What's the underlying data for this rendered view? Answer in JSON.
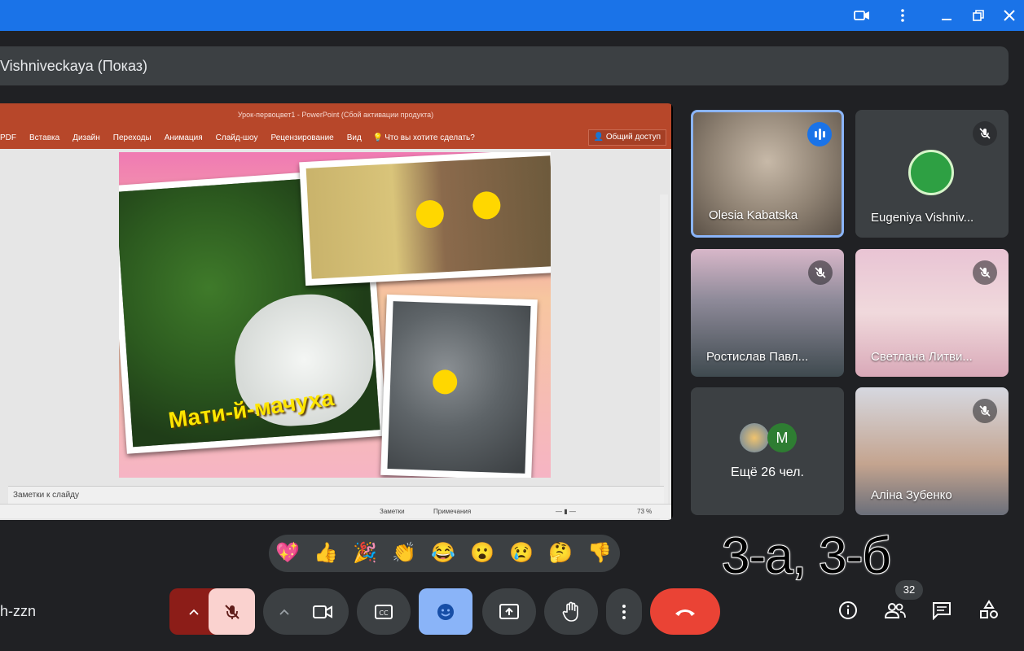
{
  "window": {
    "icons": [
      "camera-icon",
      "more-vert-icon",
      "minimize-icon",
      "restore-icon",
      "close-icon"
    ]
  },
  "presentation": {
    "banner_text": "Vishniveckaya (Показ)",
    "powerpoint": {
      "title": "Урок-первоцвет1 - PowerPoint (Сбой активации продукта)",
      "ribbon_tabs": [
        "PDF",
        "Вставка",
        "Дизайн",
        "Переходы",
        "Анимация",
        "Слайд-шоу",
        "Рецензирование",
        "Вид"
      ],
      "tell_me": "Что вы хотите сделать?",
      "share": "Общий доступ",
      "slide_caption": "Мати-й-мачуха",
      "notes_placeholder": "Заметки к слайду",
      "status_notes": "Заметки",
      "status_comments": "Примечания",
      "zoom": "73 %"
    }
  },
  "participants": [
    {
      "name": "Olesia Kabatska",
      "state": "speaking"
    },
    {
      "name": "Eugeniya Vishniv...",
      "state": "muted"
    },
    {
      "name": "Ростислав Павл...",
      "state": "muted"
    },
    {
      "name": "Светлана Литви...",
      "state": "muted"
    },
    {
      "name": "Аліна Зубенко",
      "state": "muted"
    }
  ],
  "more_tile": {
    "label": "Ещё 26 чел.",
    "avatar_letter": "M"
  },
  "reactions": [
    "💖",
    "👍",
    "🎉",
    "👏",
    "😂",
    "😮",
    "😢",
    "🤔",
    "👎"
  ],
  "overlay_text": "3-а, 3-б",
  "bottom_bar": {
    "meeting_code": "h-zzn",
    "participant_count": "32"
  },
  "colors": {
    "accent": "#1a73e8",
    "end_call": "#ea4335",
    "mic_muted_bg": "#fad2cf",
    "reactions_active": "#8ab4f8",
    "background": "#202124"
  }
}
